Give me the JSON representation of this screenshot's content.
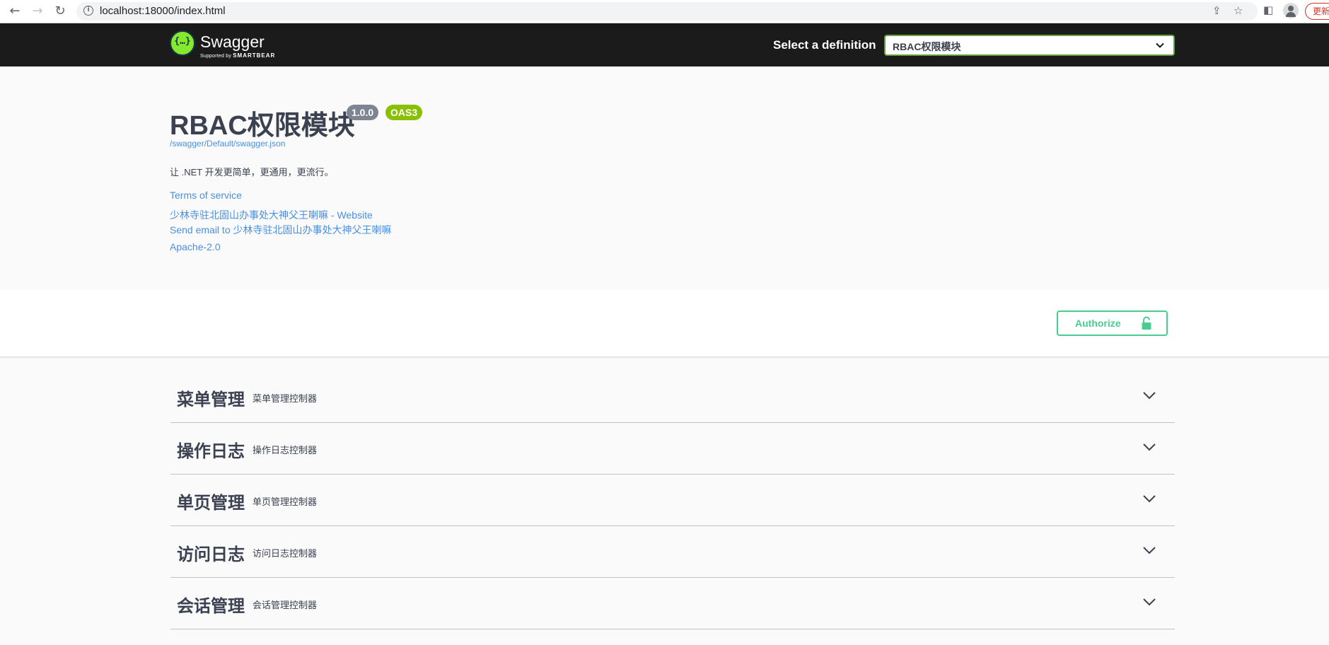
{
  "browser": {
    "url": "localhost:18000/index.html",
    "back_icon": "back-arrow-icon",
    "forward_icon": "forward-arrow-icon",
    "reload_icon": "reload-icon",
    "update_label": "更新"
  },
  "topbar": {
    "logo_name": "Swagger",
    "logo_sub_prefix": "Supported by",
    "logo_sub_brand": "SMARTBEAR",
    "definition_label": "Select a definition",
    "definition_selected": "RBAC权限模块"
  },
  "info": {
    "title": "RBAC权限模块",
    "version": "1.0.0",
    "oas_badge": "OAS3",
    "json_url": "/swagger/Default/swagger.json",
    "description": "让 .NET 开发更简单，更通用，更流行。",
    "terms": "Terms of service",
    "website": "少林寺驻北固山办事处大神父王喇嘛 - Website",
    "email": "Send email to 少林寺驻北固山办事处大神父王喇嘛",
    "license": "Apache-2.0"
  },
  "authorize": {
    "label": "Authorize",
    "color": "#49cc90"
  },
  "tags": [
    {
      "name": "菜单管理",
      "desc": "菜单管理控制器"
    },
    {
      "name": "操作日志",
      "desc": "操作日志控制器"
    },
    {
      "name": "单页管理",
      "desc": "单页管理控制器"
    },
    {
      "name": "访问日志",
      "desc": "访问日志控制器"
    },
    {
      "name": "会话管理",
      "desc": "会话管理控制器"
    }
  ],
  "colors": {
    "topbar_bg": "#1b1b1b",
    "select_border": "#62a03f",
    "link": "#4990e2",
    "version_badge": "#7d8492",
    "oas_badge": "#89bf04"
  }
}
